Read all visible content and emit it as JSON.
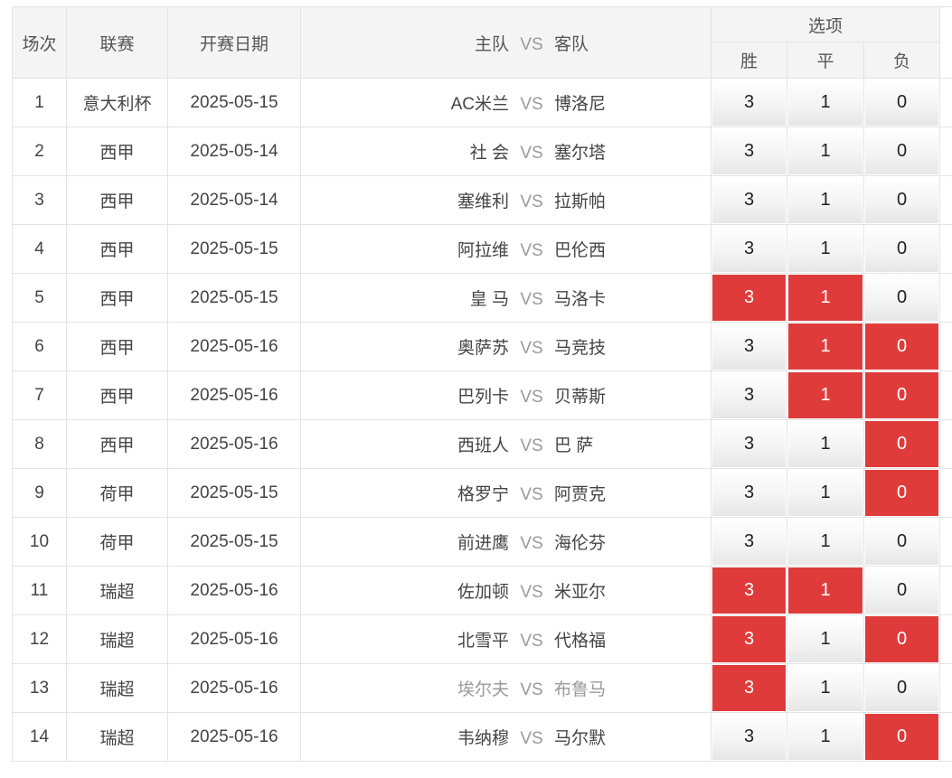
{
  "header": {
    "col_no": "场次",
    "col_league": "联赛",
    "col_date": "开赛日期",
    "col_home": "主队",
    "col_vs": "VS",
    "col_away": "客队",
    "col_options": "选项",
    "opt_win": "胜",
    "opt_draw": "平",
    "opt_lose": "负"
  },
  "vs_label": "VS",
  "rows": [
    {
      "no": "1",
      "league": "意大利杯",
      "date": "2025-05-15",
      "home": "AC米兰",
      "away": "博洛尼",
      "w": "3",
      "d": "1",
      "l": "0",
      "sel_w": false,
      "sel_d": false,
      "sel_l": false,
      "dim": false
    },
    {
      "no": "2",
      "league": "西甲",
      "date": "2025-05-14",
      "home": "社 会",
      "away": "塞尔塔",
      "w": "3",
      "d": "1",
      "l": "0",
      "sel_w": false,
      "sel_d": false,
      "sel_l": false,
      "dim": false
    },
    {
      "no": "3",
      "league": "西甲",
      "date": "2025-05-14",
      "home": "塞维利",
      "away": "拉斯帕",
      "w": "3",
      "d": "1",
      "l": "0",
      "sel_w": false,
      "sel_d": false,
      "sel_l": false,
      "dim": false
    },
    {
      "no": "4",
      "league": "西甲",
      "date": "2025-05-15",
      "home": "阿拉维",
      "away": "巴伦西",
      "w": "3",
      "d": "1",
      "l": "0",
      "sel_w": false,
      "sel_d": false,
      "sel_l": false,
      "dim": false
    },
    {
      "no": "5",
      "league": "西甲",
      "date": "2025-05-15",
      "home": "皇 马",
      "away": "马洛卡",
      "w": "3",
      "d": "1",
      "l": "0",
      "sel_w": true,
      "sel_d": true,
      "sel_l": false,
      "dim": false
    },
    {
      "no": "6",
      "league": "西甲",
      "date": "2025-05-16",
      "home": "奥萨苏",
      "away": "马竞技",
      "w": "3",
      "d": "1",
      "l": "0",
      "sel_w": false,
      "sel_d": true,
      "sel_l": true,
      "dim": false
    },
    {
      "no": "7",
      "league": "西甲",
      "date": "2025-05-16",
      "home": "巴列卡",
      "away": "贝蒂斯",
      "w": "3",
      "d": "1",
      "l": "0",
      "sel_w": false,
      "sel_d": true,
      "sel_l": true,
      "dim": false
    },
    {
      "no": "8",
      "league": "西甲",
      "date": "2025-05-16",
      "home": "西班人",
      "away": "巴 萨",
      "w": "3",
      "d": "1",
      "l": "0",
      "sel_w": false,
      "sel_d": false,
      "sel_l": true,
      "dim": false
    },
    {
      "no": "9",
      "league": "荷甲",
      "date": "2025-05-15",
      "home": "格罗宁",
      "away": "阿贾克",
      "w": "3",
      "d": "1",
      "l": "0",
      "sel_w": false,
      "sel_d": false,
      "sel_l": true,
      "dim": false
    },
    {
      "no": "10",
      "league": "荷甲",
      "date": "2025-05-15",
      "home": "前进鹰",
      "away": "海伦芬",
      "w": "3",
      "d": "1",
      "l": "0",
      "sel_w": false,
      "sel_d": false,
      "sel_l": false,
      "dim": false
    },
    {
      "no": "11",
      "league": "瑞超",
      "date": "2025-05-16",
      "home": "佐加顿",
      "away": "米亚尔",
      "w": "3",
      "d": "1",
      "l": "0",
      "sel_w": true,
      "sel_d": true,
      "sel_l": false,
      "dim": false
    },
    {
      "no": "12",
      "league": "瑞超",
      "date": "2025-05-16",
      "home": "北雪平",
      "away": "代格福",
      "w": "3",
      "d": "1",
      "l": "0",
      "sel_w": true,
      "sel_d": false,
      "sel_l": true,
      "dim": false
    },
    {
      "no": "13",
      "league": "瑞超",
      "date": "2025-05-16",
      "home": "埃尔夫",
      "away": "布鲁马",
      "w": "3",
      "d": "1",
      "l": "0",
      "sel_w": true,
      "sel_d": false,
      "sel_l": false,
      "dim": true
    },
    {
      "no": "14",
      "league": "瑞超",
      "date": "2025-05-16",
      "home": "韦纳穆",
      "away": "马尔默",
      "w": "3",
      "d": "1",
      "l": "0",
      "sel_w": false,
      "sel_d": false,
      "sel_l": true,
      "dim": false
    }
  ],
  "colors": {
    "selected": "#e03b3b",
    "header_bg": "#f4f4f4",
    "border": "#e3e3e3"
  }
}
